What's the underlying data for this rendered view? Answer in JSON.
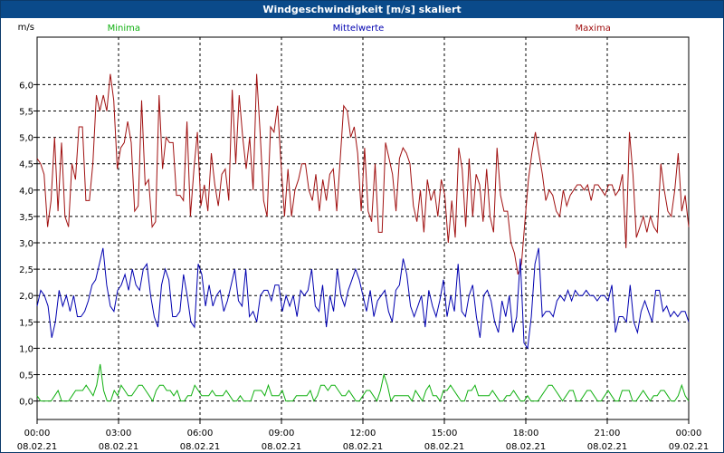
{
  "window": {
    "title": "Windgeschwindigkeit [m/s] skaliert"
  },
  "chart_data": {
    "type": "line",
    "ylabel": "m/s",
    "ylim": [
      -0.35,
      6.9
    ],
    "xlim": [
      0,
      24
    ],
    "y_ticks": [
      "0,0",
      "0,5",
      "1,0",
      "1,5",
      "2,0",
      "2,5",
      "3,0",
      "3,5",
      "4,0",
      "4,5",
      "5,0",
      "5,5",
      "6,0"
    ],
    "y_tick_values": [
      0,
      0.5,
      1,
      1.5,
      2,
      2.5,
      3,
      3.5,
      4,
      4.5,
      5,
      5.5,
      6
    ],
    "x_ticks": [
      {
        "t": 0,
        "time": "00:00",
        "date": "08.02.21"
      },
      {
        "t": 3,
        "time": "03:00",
        "date": "08.02.21"
      },
      {
        "t": 6,
        "time": "06:00",
        "date": "08.02.21"
      },
      {
        "t": 9,
        "time": "09:00",
        "date": "08.02.21"
      },
      {
        "t": 12,
        "time": "12:00",
        "date": "08.02.21"
      },
      {
        "t": 15,
        "time": "15:00",
        "date": "08.02.21"
      },
      {
        "t": 18,
        "time": "18:00",
        "date": "08.02.21"
      },
      {
        "t": 21,
        "time": "21:00",
        "date": "08.02.21"
      },
      {
        "t": 24,
        "time": "00:00",
        "date": "09.02.21"
      }
    ],
    "grid": true,
    "legend_position": "top",
    "series": [
      {
        "name": "Maxima",
        "color": "#a01010",
        "values": [
          4.6,
          4.5,
          4.3,
          3.3,
          3.8,
          5.0,
          3.6,
          4.9,
          3.5,
          3.3,
          4.5,
          4.2,
          5.2,
          5.2,
          3.8,
          3.8,
          4.5,
          5.8,
          5.5,
          5.8,
          5.5,
          6.2,
          5.7,
          4.4,
          4.8,
          4.9,
          5.3,
          4.9,
          3.6,
          3.7,
          5.7,
          4.1,
          4.2,
          3.3,
          3.4,
          5.8,
          4.4,
          5.0,
          4.9,
          4.9,
          3.9,
          3.9,
          3.8,
          5.3,
          3.5,
          4.4,
          5.1,
          3.7,
          4.1,
          3.6,
          4.7,
          4.1,
          3.7,
          4.3,
          4.4,
          3.8,
          5.9,
          4.5,
          5.8,
          5.0,
          4.4,
          5.0,
          4.0,
          6.2,
          5.1,
          3.8,
          3.5,
          5.2,
          5.1,
          5.6,
          4.5,
          3.5,
          4.4,
          3.5,
          4.0,
          4.2,
          4.5,
          4.5,
          4.0,
          3.8,
          4.3,
          3.6,
          4.2,
          3.8,
          4.3,
          4.4,
          3.6,
          4.6,
          5.6,
          5.5,
          5.0,
          5.2,
          4.7,
          3.6,
          4.8,
          3.6,
          3.4,
          4.5,
          3.2,
          3.2,
          4.9,
          4.6,
          4.3,
          3.6,
          4.6,
          4.8,
          4.7,
          4.5,
          3.7,
          3.4,
          4.0,
          3.2,
          4.2,
          3.8,
          4.0,
          3.5,
          4.2,
          3.9,
          3.0,
          3.8,
          3.1,
          4.8,
          4.4,
          3.3,
          4.6,
          3.5,
          4.3,
          4.1,
          3.4,
          4.4,
          3.5,
          3.2,
          4.8,
          3.9,
          3.6,
          3.6,
          3.0,
          2.8,
          2.4,
          2.6,
          3.4,
          4.2,
          4.7,
          5.1,
          4.7,
          4.3,
          3.8,
          4.0,
          3.9,
          3.6,
          3.5,
          4.0,
          3.7,
          3.9,
          4.0,
          4.1,
          4.1,
          4.0,
          4.1,
          3.8,
          4.1,
          4.1,
          4.0,
          3.9,
          4.1,
          4.1,
          3.9,
          4.0,
          4.3,
          2.9,
          5.1,
          4.3,
          3.1,
          3.3,
          3.5,
          3.2,
          3.5,
          3.3,
          3.2,
          4.5,
          4.0,
          3.6,
          3.5,
          4.0,
          4.7,
          3.6,
          3.9,
          3.3
        ]
      },
      {
        "name": "Mittelwerte",
        "color": "#0000b0",
        "values": [
          1.8,
          2.1,
          2.0,
          1.8,
          1.2,
          1.5,
          2.1,
          1.8,
          2.0,
          1.7,
          2.0,
          1.6,
          1.6,
          1.7,
          1.9,
          2.2,
          2.3,
          2.6,
          2.9,
          2.2,
          1.8,
          1.7,
          2.1,
          2.2,
          2.4,
          2.1,
          2.5,
          2.2,
          2.1,
          2.5,
          2.6,
          2.0,
          1.6,
          1.4,
          2.2,
          2.5,
          2.3,
          1.6,
          1.6,
          1.7,
          2.4,
          2.0,
          1.5,
          1.4,
          2.6,
          2.4,
          1.8,
          2.2,
          1.8,
          2.0,
          2.1,
          1.7,
          1.9,
          2.2,
          2.5,
          1.9,
          1.8,
          2.5,
          1.6,
          1.7,
          1.5,
          2.0,
          2.1,
          2.1,
          1.9,
          2.2,
          2.2,
          1.7,
          2.0,
          1.8,
          2.0,
          1.6,
          2.1,
          2.0,
          2.1,
          2.5,
          1.8,
          1.7,
          2.2,
          1.4,
          2.0,
          1.7,
          2.5,
          2.0,
          1.8,
          2.1,
          2.3,
          2.5,
          2.3,
          2.0,
          1.7,
          2.1,
          1.6,
          1.9,
          2.0,
          2.1,
          1.7,
          1.5,
          2.1,
          2.2,
          2.7,
          2.4,
          1.8,
          1.6,
          1.8,
          2.0,
          1.4,
          2.1,
          1.8,
          1.6,
          1.9,
          2.3,
          1.6,
          2.0,
          1.7,
          2.6,
          1.7,
          1.6,
          2.0,
          2.2,
          1.6,
          1.2,
          2.0,
          2.1,
          1.9,
          1.5,
          1.3,
          1.9,
          1.6,
          2.0,
          1.3,
          1.6,
          2.7,
          1.1,
          1.0,
          1.6,
          2.6,
          2.9,
          1.6,
          1.7,
          1.7,
          1.6,
          1.9,
          2.0,
          1.9,
          2.1,
          1.9,
          2.1,
          2.0,
          2.0,
          2.1,
          2.0,
          2.0,
          1.9,
          2.0,
          2.0,
          1.9,
          2.2,
          1.3,
          1.6,
          1.6,
          1.5,
          2.2,
          1.5,
          1.3,
          1.7,
          1.9,
          1.7,
          1.5,
          2.1,
          2.1,
          1.7,
          1.8,
          1.6,
          1.7,
          1.6,
          1.7,
          1.7,
          1.5
        ]
      },
      {
        "name": "Minima",
        "color": "#10b010",
        "values": [
          0.1,
          0.0,
          0.0,
          0.0,
          0.0,
          0.1,
          0.2,
          0.0,
          0.0,
          0.0,
          0.1,
          0.2,
          0.2,
          0.2,
          0.3,
          0.2,
          0.1,
          0.3,
          0.7,
          0.2,
          0.0,
          0.0,
          0.2,
          0.1,
          0.3,
          0.2,
          0.1,
          0.1,
          0.2,
          0.3,
          0.3,
          0.2,
          0.1,
          0.0,
          0.2,
          0.3,
          0.3,
          0.2,
          0.2,
          0.1,
          0.2,
          0.0,
          0.0,
          0.1,
          0.1,
          0.3,
          0.2,
          0.1,
          0.1,
          0.1,
          0.2,
          0.1,
          0.1,
          0.1,
          0.2,
          0.1,
          0.0,
          0.0,
          0.1,
          0.0,
          0.0,
          0.0,
          0.2,
          0.2,
          0.2,
          0.1,
          0.3,
          0.1,
          0.1,
          0.1,
          0.2,
          0.0,
          0.0,
          0.0,
          0.1,
          0.1,
          0.1,
          0.1,
          0.2,
          0.0,
          0.1,
          0.3,
          0.3,
          0.2,
          0.3,
          0.3,
          0.2,
          0.1,
          0.1,
          0.2,
          0.1,
          0.0,
          0.0,
          0.1,
          0.2,
          0.2,
          0.1,
          0.0,
          0.2,
          0.5,
          0.3,
          0.0,
          0.1,
          0.1,
          0.1,
          0.1,
          0.1,
          0.0,
          0.2,
          0.1,
          0.0,
          0.2,
          0.3,
          0.1,
          0.1,
          0.0,
          0.2,
          0.2,
          0.3,
          0.2,
          0.1,
          0.0,
          0.0,
          0.2,
          0.2,
          0.3,
          0.1,
          0.1,
          0.1,
          0.1,
          0.2,
          0.1,
          0.0,
          0.0,
          0.1,
          0.1,
          0.2,
          0.1,
          0.0,
          0.0,
          0.1,
          0.0,
          0.0,
          0.0,
          0.1,
          0.2,
          0.3,
          0.3,
          0.2,
          0.1,
          0.0,
          0.1,
          0.2,
          0.2,
          0.0,
          0.0,
          0.1,
          0.2,
          0.2,
          0.1,
          0.0,
          0.0,
          0.1,
          0.2,
          0.1,
          0.0,
          0.0,
          0.2,
          0.2,
          0.2,
          0.0,
          0.0,
          0.1,
          0.2,
          0.1,
          0.0,
          0.1,
          0.1,
          0.2,
          0.2,
          0.1,
          0.0,
          0.0,
          0.1,
          0.3,
          0.1,
          0.0
        ]
      }
    ]
  }
}
